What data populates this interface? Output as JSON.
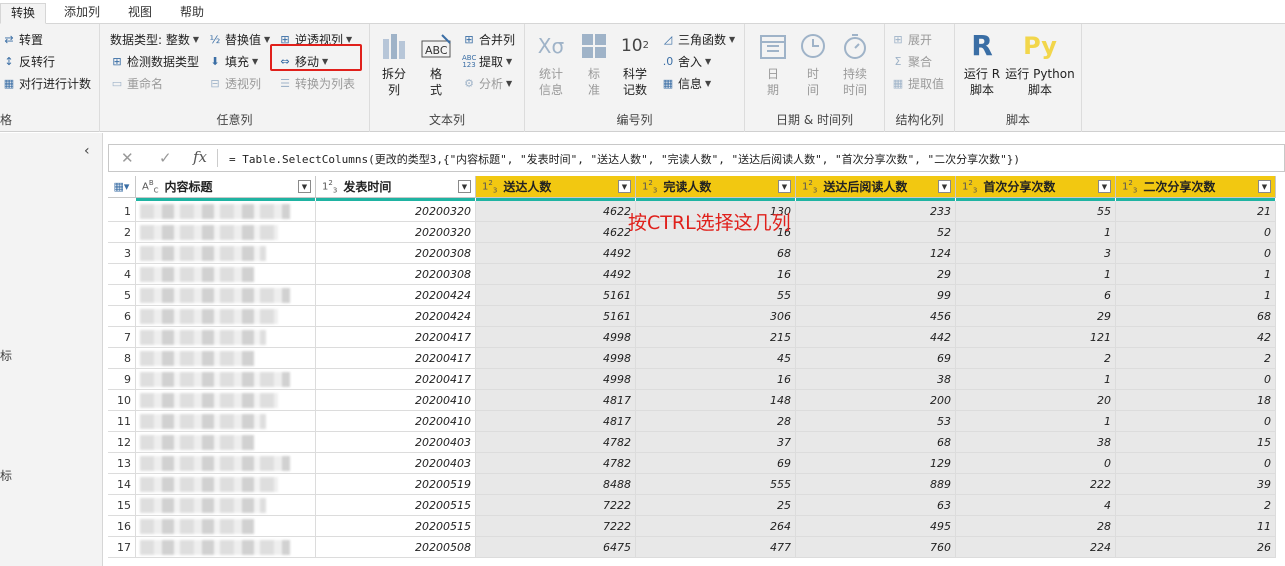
{
  "tabs": [
    {
      "label": "转换",
      "active": true
    },
    {
      "label": "添加列",
      "active": false
    },
    {
      "label": "视图",
      "active": false
    },
    {
      "label": "帮助",
      "active": false
    }
  ],
  "ribbon": {
    "table_group": {
      "label": "格",
      "transpose": "转置",
      "reverse_rows": "反转行",
      "count_rows": "对行进行计数"
    },
    "any_column": {
      "label": "任意列",
      "data_type": "数据类型: 整数",
      "detect_type": "检测数据类型",
      "rename": "重命名",
      "replace_values": "替换值",
      "fill": "填充",
      "pivot": "透视列",
      "unpivot": "逆透视列",
      "move": "移动",
      "to_list": "转换为列表"
    },
    "text_column": {
      "label": "文本列",
      "split": "拆分\n列",
      "format": "格\n式",
      "merge": "合并列",
      "extract": "提取",
      "parse": "分析"
    },
    "number_column": {
      "label": "编号列",
      "statistics": "统计\n信息",
      "standard": "标\n准",
      "scientific": "科学\n记数",
      "trig": "三角函数",
      "rounding": "舍入",
      "info": "信息"
    },
    "datetime_column": {
      "label": "日期 & 时间列",
      "date": "日\n期",
      "time": "时\n间",
      "duration": "持续\n时间"
    },
    "structured_column": {
      "label": "结构化列",
      "expand": "展开",
      "aggregate": "聚合",
      "extract_values": "提取值"
    },
    "scripts": {
      "label": "脚本",
      "run_r": "运行 R\n脚本",
      "run_python": "运行 Python\n脚本"
    }
  },
  "leftpane": {
    "label_1": "标",
    "label_2": "标"
  },
  "formula": "= Table.SelectColumns(更改的类型3,{\"内容标题\", \"发表时间\", \"送达人数\", \"完读人数\", \"送达后阅读人数\", \"首次分享次数\", \"二次分享次数\"})",
  "columns": [
    {
      "name": "内容标题",
      "type_icon": "ABC",
      "selected": false
    },
    {
      "name": "发表时间",
      "type_icon": "123",
      "selected": false
    },
    {
      "name": "送达人数",
      "type_icon": "123",
      "selected": true
    },
    {
      "name": "完读人数",
      "type_icon": "123",
      "selected": true
    },
    {
      "name": "送达后阅读人数",
      "type_icon": "123",
      "selected": true
    },
    {
      "name": "首次分享次数",
      "type_icon": "123",
      "selected": true
    },
    {
      "name": "二次分享次数",
      "type_icon": "123",
      "selected": true
    }
  ],
  "rows": [
    {
      "n": "1",
      "date": "20200320",
      "v": [
        "4622",
        "130",
        "233",
        "55",
        "21"
      ]
    },
    {
      "n": "2",
      "date": "20200320",
      "v": [
        "4622",
        "16",
        "52",
        "1",
        "0"
      ]
    },
    {
      "n": "3",
      "date": "20200308",
      "v": [
        "4492",
        "68",
        "124",
        "3",
        "0"
      ]
    },
    {
      "n": "4",
      "date": "20200308",
      "v": [
        "4492",
        "16",
        "29",
        "1",
        "1"
      ]
    },
    {
      "n": "5",
      "date": "20200424",
      "v": [
        "5161",
        "55",
        "99",
        "6",
        "1"
      ]
    },
    {
      "n": "6",
      "date": "20200424",
      "v": [
        "5161",
        "306",
        "456",
        "29",
        "68"
      ]
    },
    {
      "n": "7",
      "date": "20200417",
      "v": [
        "4998",
        "215",
        "442",
        "121",
        "42"
      ]
    },
    {
      "n": "8",
      "date": "20200417",
      "v": [
        "4998",
        "45",
        "69",
        "2",
        "2"
      ]
    },
    {
      "n": "9",
      "date": "20200417",
      "v": [
        "4998",
        "16",
        "38",
        "1",
        "0"
      ]
    },
    {
      "n": "10",
      "date": "20200410",
      "v": [
        "4817",
        "148",
        "200",
        "20",
        "18"
      ]
    },
    {
      "n": "11",
      "date": "20200410",
      "v": [
        "4817",
        "28",
        "53",
        "1",
        "0"
      ]
    },
    {
      "n": "12",
      "date": "20200403",
      "v": [
        "4782",
        "37",
        "68",
        "38",
        "15"
      ]
    },
    {
      "n": "13",
      "date": "20200403",
      "v": [
        "4782",
        "69",
        "129",
        "0",
        "0"
      ]
    },
    {
      "n": "14",
      "date": "20200519",
      "v": [
        "8488",
        "555",
        "889",
        "222",
        "39"
      ]
    },
    {
      "n": "15",
      "date": "20200515",
      "v": [
        "7222",
        "25",
        "63",
        "4",
        "2"
      ]
    },
    {
      "n": "16",
      "date": "20200515",
      "v": [
        "7222",
        "264",
        "495",
        "28",
        "11"
      ]
    },
    {
      "n": "17",
      "date": "20200508",
      "v": [
        "6475",
        "477",
        "760",
        "224",
        "26"
      ]
    }
  ],
  "annotation": "按CTRL选择这几列",
  "colors": {
    "selected_header": "#f2c811",
    "selected_cell": "#e8e8e8",
    "highlight_box": "#e0201b",
    "quality_bar": "#1fb3a2"
  }
}
